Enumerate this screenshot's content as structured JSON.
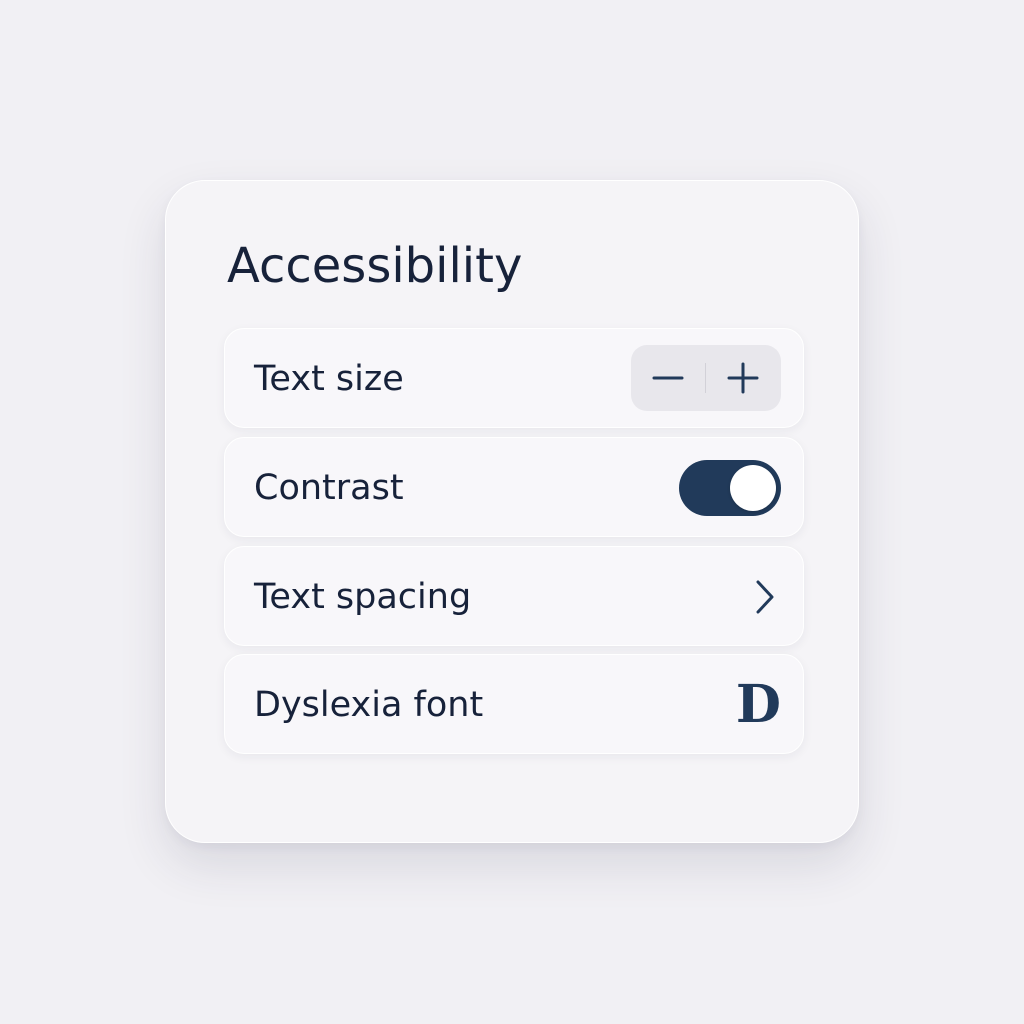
{
  "panel": {
    "title": "Accessibility"
  },
  "settings": [
    {
      "label": "Text size",
      "control": "stepper",
      "decrease_icon": "minus-icon",
      "increase_icon": "plus-icon"
    },
    {
      "label": "Contrast",
      "control": "toggle",
      "state": "on"
    },
    {
      "label": "Text spacing",
      "control": "disclosure",
      "icon": "chevron-right-icon"
    },
    {
      "label": "Dyslexia font",
      "control": "font-glyph",
      "glyph": "D"
    }
  ],
  "colors": {
    "background": "#f1f0f4",
    "panel": "#f5f4f7",
    "row": "#f8f7fa",
    "text": "#17223a",
    "accent": "#213a5a",
    "stepper_bg": "#e8e7ec"
  }
}
